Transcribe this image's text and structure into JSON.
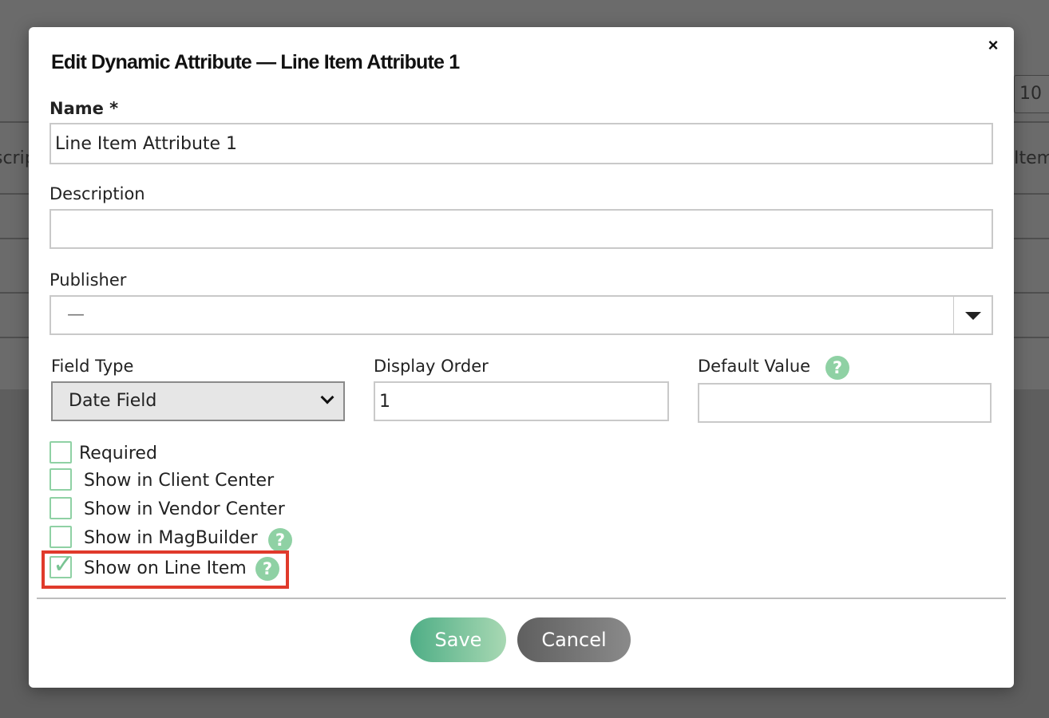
{
  "background": {
    "rows_text": "10",
    "left_header": "scrip",
    "right_header": "Item"
  },
  "modal": {
    "title": "Edit Dynamic Attribute — Line Item Attribute 1",
    "close_glyph": "×",
    "name": {
      "label": "Name *",
      "value": "Line Item Attribute 1"
    },
    "description": {
      "label": "Description",
      "value": ""
    },
    "publisher": {
      "label": "Publisher",
      "value": "—"
    },
    "field_type": {
      "label": "Field Type",
      "value": "Date Field"
    },
    "display_order": {
      "label": "Display Order",
      "value": "1"
    },
    "default_value": {
      "label": "Default Value",
      "value": ""
    },
    "help_glyph": "?",
    "checkboxes": [
      {
        "label": "Required",
        "checked": false
      },
      {
        "label": "Show in Client Center",
        "checked": false
      },
      {
        "label": "Show in Vendor Center",
        "checked": false
      },
      {
        "label": "Show in MagBuilder",
        "checked": false
      },
      {
        "label": "Show on Line Item",
        "checked": true
      }
    ],
    "check_glyph": "✓",
    "buttons": {
      "save": "Save",
      "cancel": "Cancel"
    },
    "colors": {
      "accent_green": "#8fd1a4",
      "save_gradient_start": "#4fae86",
      "cancel_gray": "#6f6f6f",
      "highlight_red": "#e03a2b"
    }
  }
}
